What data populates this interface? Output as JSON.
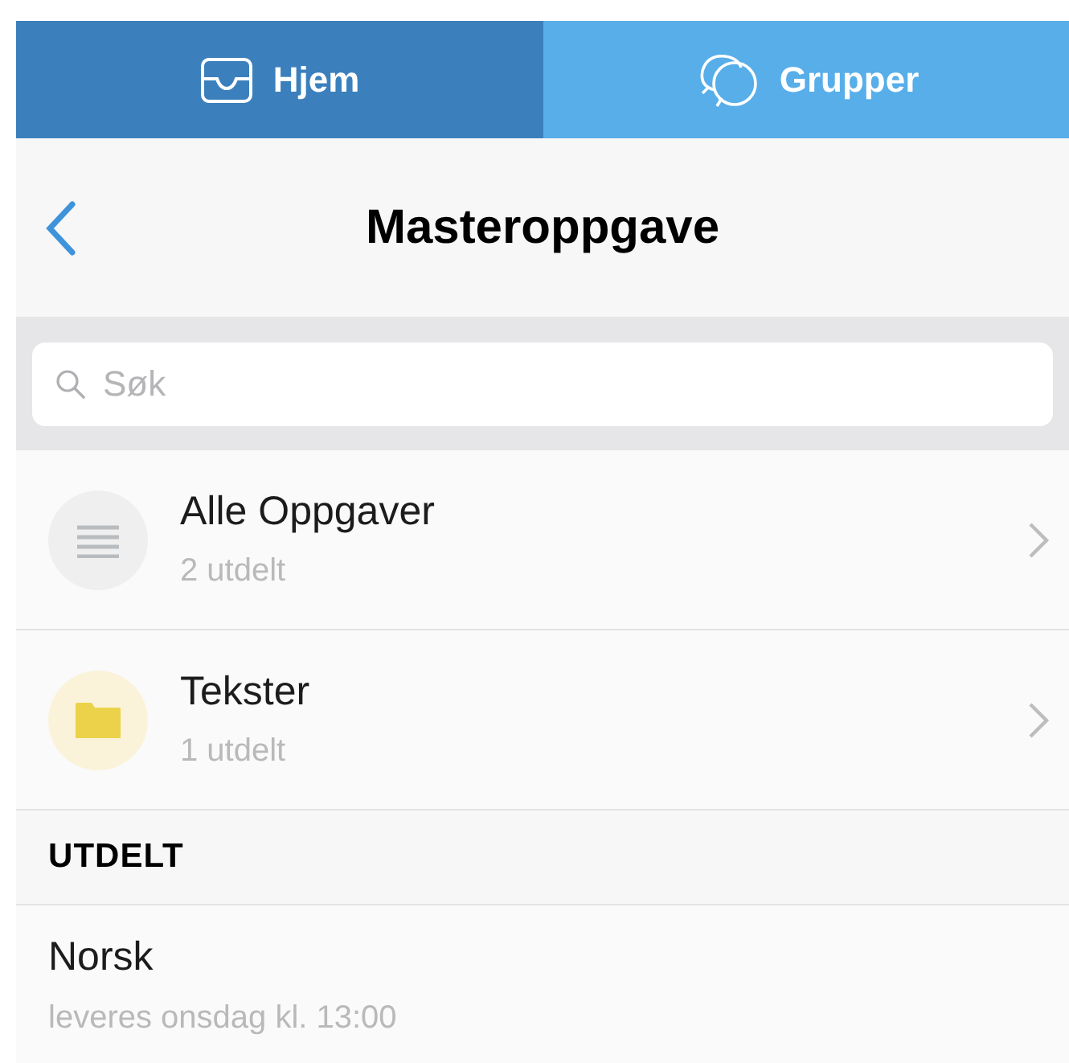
{
  "tabs": [
    {
      "label": "Hjem",
      "kind": "inbox",
      "selected": true
    },
    {
      "label": "Grupper",
      "kind": "chat",
      "selected": false
    }
  ],
  "nav": {
    "title": "Masteroppgave"
  },
  "search": {
    "placeholder": "Søk"
  },
  "folders": [
    {
      "title": "Alle Oppgaver",
      "subtitle": "2 utdelt",
      "kind": "list"
    },
    {
      "title": "Tekster",
      "subtitle": "1 utdelt",
      "kind": "folder"
    }
  ],
  "section": {
    "title": "UTDELT"
  },
  "assignments": [
    {
      "title": "Norsk",
      "subtitle": "leveres onsdag kl. 13:00"
    }
  ]
}
